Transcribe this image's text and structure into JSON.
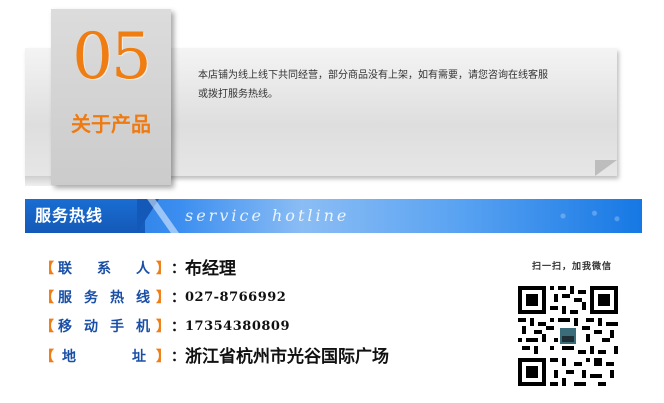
{
  "about": {
    "number": "05",
    "title": "关于产品",
    "text_line1": "本店铺为线上线下共同经营，部分商品没有上架，如有需要，请您咨询在线客服",
    "text_line2": "或拨打服务热线。"
  },
  "service_bar": {
    "title": "服务热线",
    "subtitle": "service hotline"
  },
  "contacts": [
    {
      "bracket_open": "【",
      "label": "联系人",
      "bracket_close": "】",
      "colon": "：",
      "value": "布经理"
    },
    {
      "bracket_open": "【",
      "label": "服务热线",
      "bracket_close": "】",
      "colon": "：",
      "value": "027-8766992"
    },
    {
      "bracket_open": "【",
      "label": "移动手机",
      "bracket_close": "】",
      "colon": "：",
      "value": "17354380809"
    },
    {
      "bracket_open": "【",
      "label": "地址",
      "bracket_close": "】",
      "colon": "：",
      "value": "浙江省杭州市光谷国际广场"
    }
  ],
  "qr": {
    "caption": "扫一扫，加我微信",
    "icon": "wechat-qr-code"
  },
  "colors": {
    "accent_orange": "#f07d12",
    "label_blue": "#1a4fa6",
    "bar_blue": "#1a6fd6"
  }
}
